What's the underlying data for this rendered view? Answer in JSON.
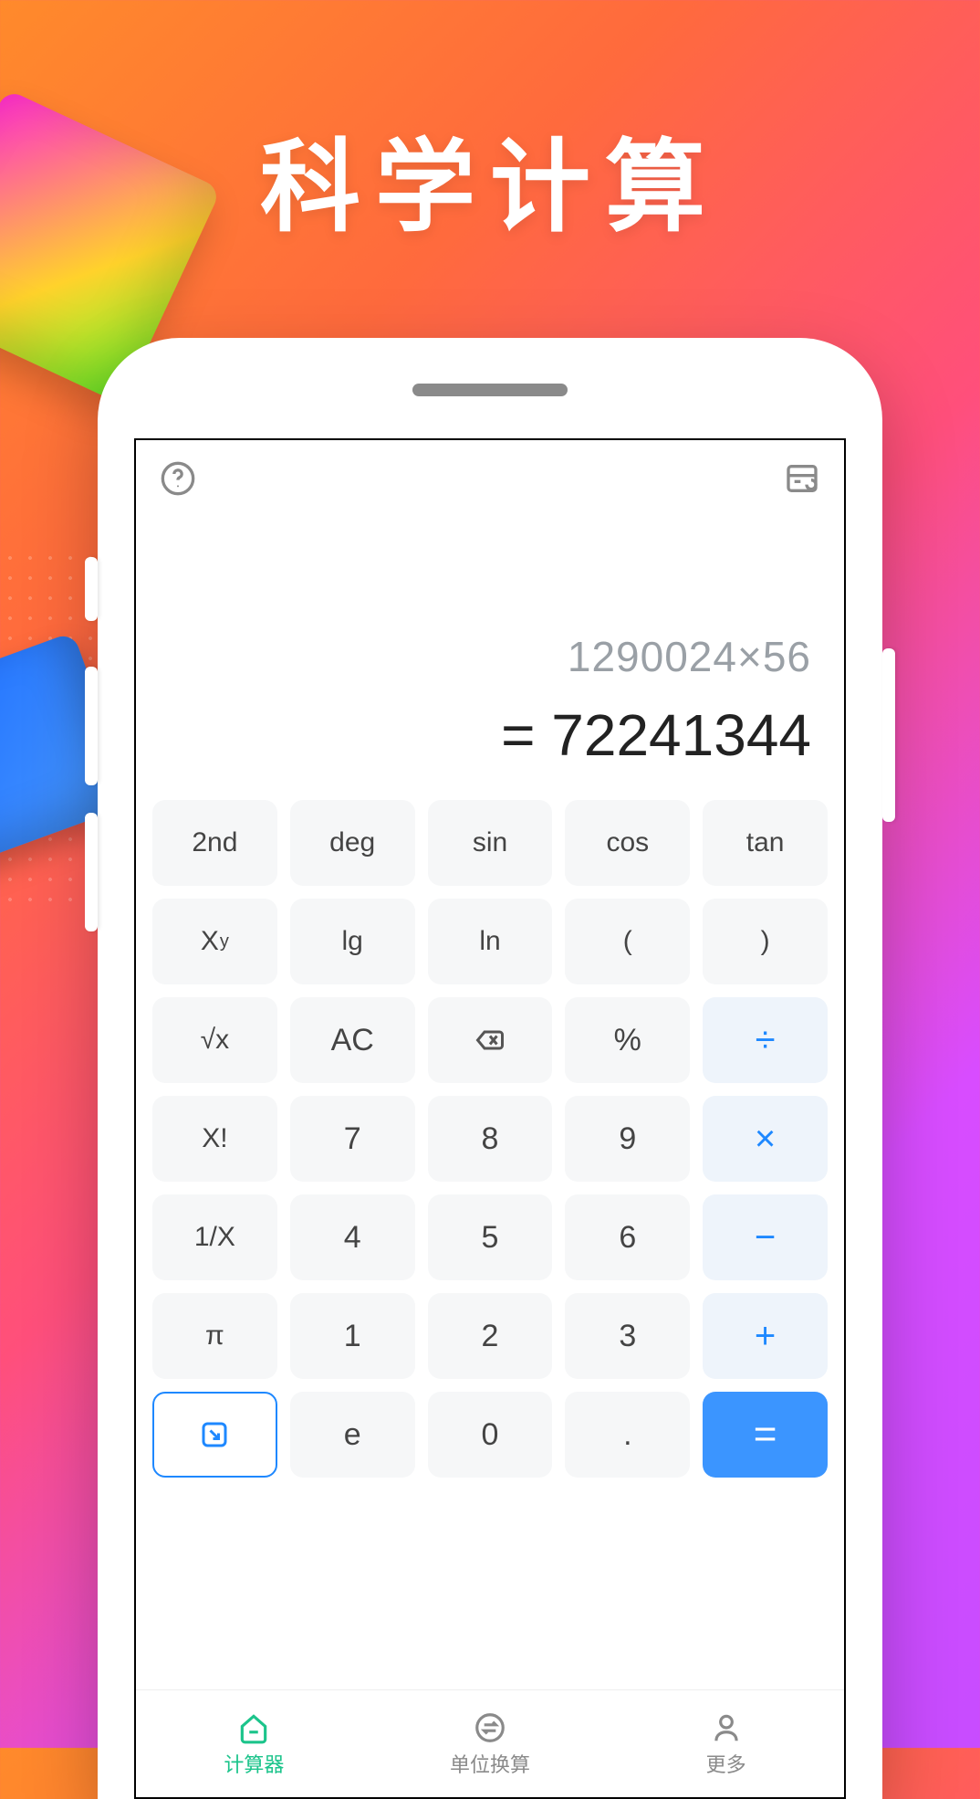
{
  "hero": {
    "title": "科学计算"
  },
  "display": {
    "expression": "1290024×56",
    "result": "= 72241344"
  },
  "keys": {
    "r0": [
      "2nd",
      "deg",
      "sin",
      "cos",
      "tan"
    ],
    "r1_xy_base": "X",
    "r1_xy_sup": "y",
    "r1": [
      "lg",
      "ln",
      "(",
      ")"
    ],
    "r2_sqrt": "√x",
    "r2_ac": "AC",
    "r2_pct": "%",
    "r2_div": "÷",
    "r3_fact": "X!",
    "r3": [
      "7",
      "8",
      "9"
    ],
    "r3_mul": "×",
    "r4_inv": "1/X",
    "r4": [
      "4",
      "5",
      "6"
    ],
    "r4_min": "−",
    "r5_pi": "π",
    "r5": [
      "1",
      "2",
      "3"
    ],
    "r5_add": "+",
    "r6_e": "e",
    "r6_0": "0",
    "r6_dot": ".",
    "r6_eq": "="
  },
  "nav": {
    "calc": "计算器",
    "convert": "单位换算",
    "more": "更多"
  }
}
